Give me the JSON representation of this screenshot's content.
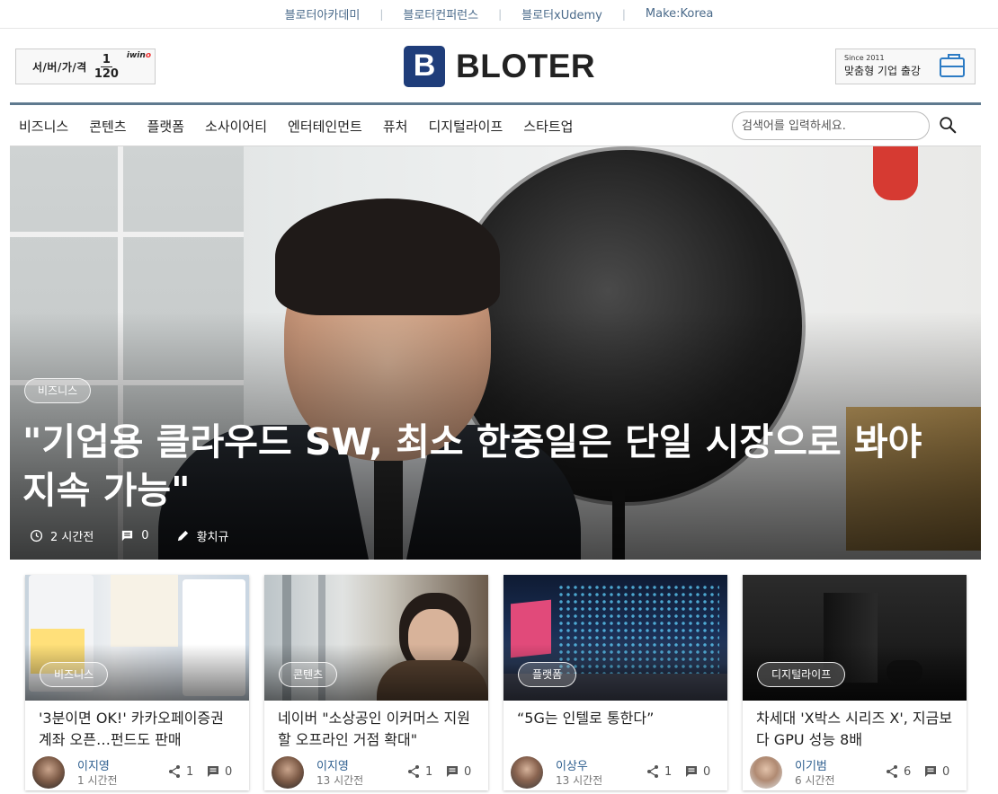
{
  "topbar": {
    "links": [
      "블로터아카데미",
      "블로터컨퍼런스",
      "블로터xUdemy",
      "Make:Korea"
    ],
    "separator": "|"
  },
  "ad_left": {
    "text": "서/버/가/격",
    "numerator": "1",
    "denominator": "120",
    "brand_prefix": "iwin",
    "brand_suffix": "o"
  },
  "logo": {
    "mark": "B",
    "word": "BLOTER",
    "color": "#1f3d7a"
  },
  "ad_right": {
    "since": "Since 2011",
    "text": "맞춤형 기업 출강",
    "icon": "briefcase-icon"
  },
  "nav": {
    "items": [
      "비즈니스",
      "콘텐츠",
      "플랫폼",
      "소사이어티",
      "엔터테인먼트",
      "퓨처",
      "디지털라이프",
      "스타트업"
    ],
    "search_placeholder": "검색어를 입력하세요.",
    "search_icon": "search-icon"
  },
  "hero": {
    "category": "비즈니스",
    "title": "\"기업용 클라우드 SW, 최소 한중일은 단일 시장으로 봐야 지속 가능\"",
    "time": "2 시간전",
    "comments": "0",
    "author": "황치규"
  },
  "cards": [
    {
      "category": "비즈니스",
      "title": "'3분이면 OK!' 카카오페이증권 계좌 오픈…펀드도 판매",
      "author": "이지영",
      "time": "1 시간전",
      "shares": "1",
      "comments": "0"
    },
    {
      "category": "콘텐츠",
      "title": "네이버 \"소상공인 이커머스 지원할 오프라인 거점 확대\"",
      "author": "이지영",
      "time": "13 시간전",
      "shares": "1",
      "comments": "0"
    },
    {
      "category": "플랫폼",
      "title": "“5G는 인텔로 통한다”",
      "author": "이상우",
      "time": "13 시간전",
      "shares": "1",
      "comments": "0"
    },
    {
      "category": "디지털라이프",
      "title": "차세대 'X박스 시리즈 X', 지금보다 GPU 성능 8배",
      "author": "이기범",
      "time": "6 시간전",
      "shares": "6",
      "comments": "0"
    }
  ],
  "colors": {
    "accent": "#1f3d7a",
    "nav_rule": "#5f7a8f",
    "author_link": "#2f5f8f",
    "top_link": "#4a6a8a"
  }
}
